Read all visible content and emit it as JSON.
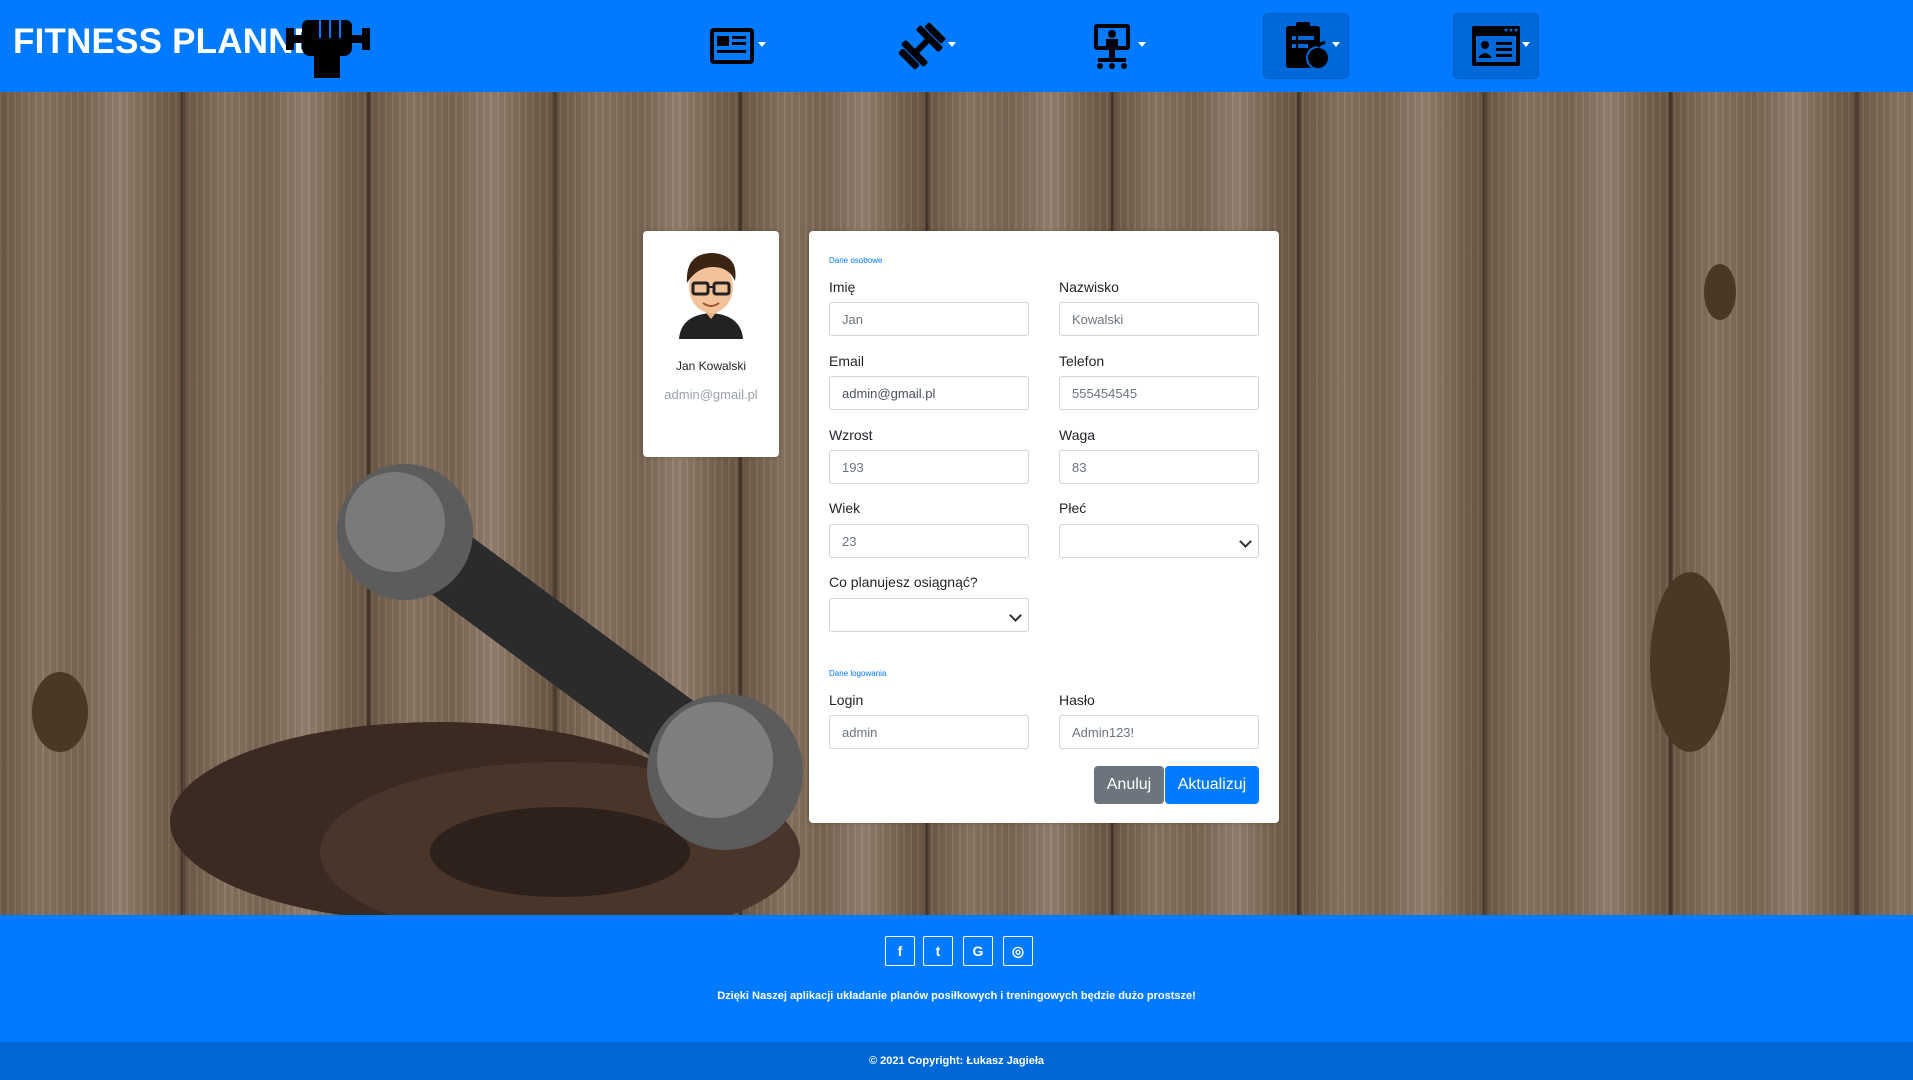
{
  "brand": {
    "title": "FITNESS PLANNER"
  },
  "nav": {
    "items": [
      {
        "icon": "news-icon"
      },
      {
        "icon": "dumbbell-icon"
      },
      {
        "icon": "trainer-icon"
      },
      {
        "icon": "diet-plan-icon",
        "active": true
      },
      {
        "icon": "profile-card-icon",
        "active": true
      }
    ]
  },
  "profile": {
    "name": "Jan Kowalski",
    "email": "admin@gmail.pl"
  },
  "form": {
    "personal_title": "Dane osobowe",
    "login_title": "Dane logowania",
    "fields": {
      "first_name": {
        "label": "Imię",
        "placeholder": "Jan"
      },
      "last_name": {
        "label": "Nazwisko",
        "placeholder": "Kowalski"
      },
      "email": {
        "label": "Email",
        "value": "admin@gmail.pl"
      },
      "phone": {
        "label": "Telefon",
        "placeholder": "555454545"
      },
      "height": {
        "label": "Wzrost",
        "placeholder": "193"
      },
      "weight": {
        "label": "Waga",
        "placeholder": "83"
      },
      "age": {
        "label": "Wiek",
        "placeholder": "23"
      },
      "gender": {
        "label": "Płeć",
        "value": ""
      },
      "goal": {
        "label": "Co planujesz osiągnąć?",
        "value": ""
      },
      "login": {
        "label": "Login",
        "placeholder": "admin"
      },
      "password": {
        "label": "Hasło",
        "placeholder": "Admin123!"
      }
    },
    "cancel_label": "Anuluj",
    "update_label": "Aktualizuj"
  },
  "footer": {
    "social": [
      {
        "icon": "facebook-icon",
        "glyph": "f"
      },
      {
        "icon": "twitter-icon",
        "glyph": "t"
      },
      {
        "icon": "google-icon",
        "glyph": "G"
      },
      {
        "icon": "instagram-icon",
        "glyph": "◎"
      }
    ],
    "tagline": "Dzięki Naszej aplikacji układanie planów posiłkowych i treningowych będzie dużo prostsze!",
    "copyright": "© 2021 Copyright: Łukasz Jagieła"
  },
  "colors": {
    "primary": "#007bff",
    "secondary": "#6c757d",
    "copyright_bar": "#0068d6"
  }
}
